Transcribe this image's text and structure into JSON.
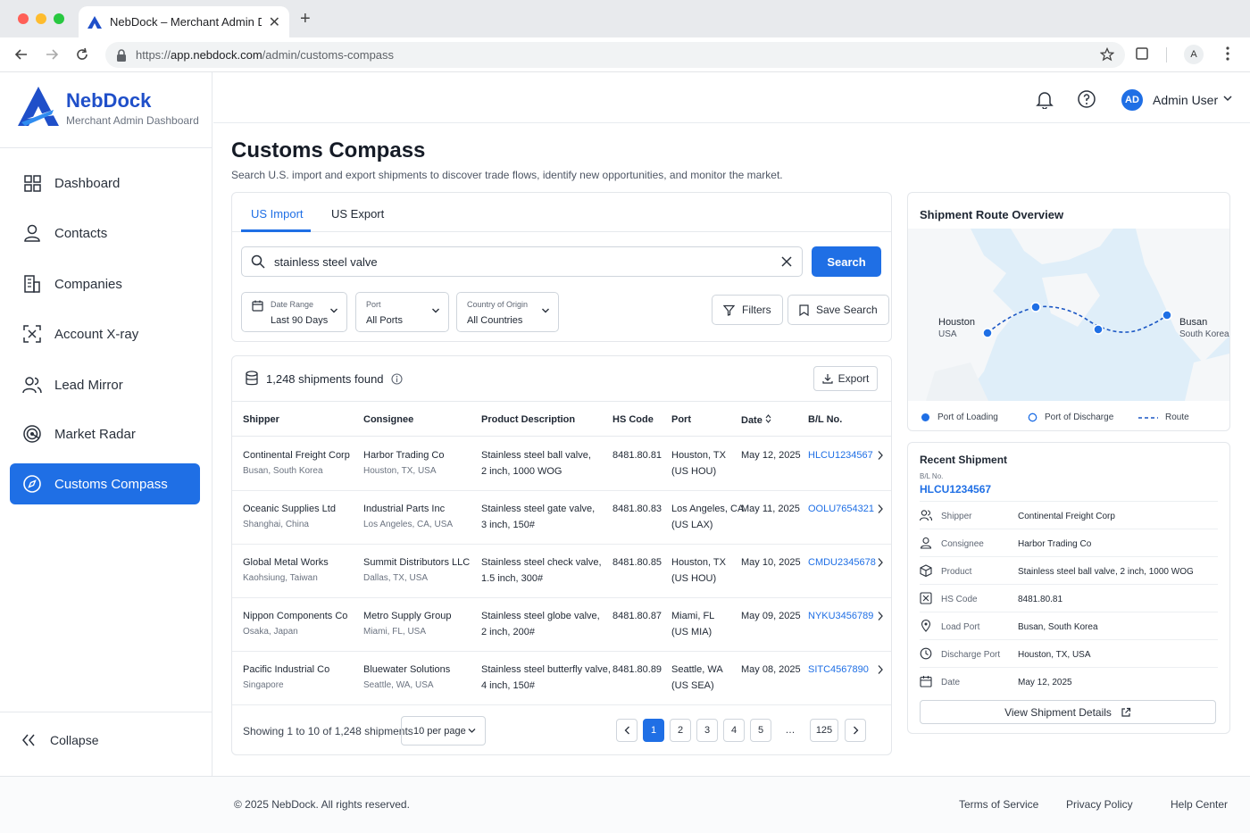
{
  "browser": {
    "tab_title": "NebDock – Merchant Admin Dashboard",
    "url_scheme": "https://",
    "url_host": "app.nebdock.com",
    "url_path": "/admin/customs-compass",
    "profile_initial": "A"
  },
  "brand": {
    "name": "NebDock",
    "subtitle": "Merchant Admin Dashboard",
    "accent": "#1f6fe5"
  },
  "sidebar": {
    "items": [
      {
        "label": "Dashboard",
        "icon": "grid-icon"
      },
      {
        "label": "Contacts",
        "icon": "user-icon"
      },
      {
        "label": "Companies",
        "icon": "building-icon"
      },
      {
        "label": "Account X-ray",
        "icon": "xray-icon"
      },
      {
        "label": "Lead Mirror",
        "icon": "users-icon"
      },
      {
        "label": "Market Radar",
        "icon": "radar-icon"
      },
      {
        "label": "Customs Compass",
        "icon": "compass-icon",
        "active": true
      }
    ],
    "collapse_label": "Collapse"
  },
  "header": {
    "avatar_initials": "AD",
    "username": "Admin User"
  },
  "page": {
    "title": "Customs Compass",
    "subtitle": "Search U.S. import and export shipments to discover trade flows, identify new opportunities, and monitor the market."
  },
  "search": {
    "tabs": [
      "US Import",
      "US Export"
    ],
    "active_tab": "US Import",
    "query": "stainless steel valve",
    "button_label": "Search",
    "filters": [
      {
        "label": "Date Range",
        "value": "Last 90 Days"
      },
      {
        "label": "Port",
        "value": "All Ports"
      },
      {
        "label": "Country of Origin",
        "value": "All Countries"
      }
    ],
    "filters_button": "Filters",
    "save_button": "Save Search"
  },
  "results": {
    "count_text": "1,248 shipments found",
    "export_label": "Export",
    "columns": [
      "Shipper",
      "Consignee",
      "Product Description",
      "HS Code",
      "Port",
      "Date",
      "B/L No."
    ],
    "rows": [
      {
        "shipper": "Continental Freight Corp",
        "shipper_loc": "Busan, South Korea",
        "consignee": "Harbor Trading Co",
        "consignee_loc": "Houston, TX, USA",
        "desc1": "Stainless steel ball valve,",
        "desc2": "2 inch, 1000 WOG",
        "hs": "8481.80.81",
        "port1": "Houston, TX",
        "port2": "(US HOU)",
        "date": "May 12, 2025",
        "bl": "HLCU1234567"
      },
      {
        "shipper": "Oceanic Supplies Ltd",
        "shipper_loc": "Shanghai, China",
        "consignee": "Industrial Parts Inc",
        "consignee_loc": "Los Angeles, CA, USA",
        "desc1": "Stainless steel gate valve,",
        "desc2": "3 inch, 150#",
        "hs": "8481.80.83",
        "port1": "Los Angeles, CA",
        "port2": "(US LAX)",
        "date": "May 11, 2025",
        "bl": "OOLU7654321"
      },
      {
        "shipper": "Global Metal Works",
        "shipper_loc": "Kaohsiung, Taiwan",
        "consignee": "Summit Distributors LLC",
        "consignee_loc": "Dallas, TX, USA",
        "desc1": "Stainless steel check valve,",
        "desc2": "1.5 inch, 300#",
        "hs": "8481.80.85",
        "port1": "Houston, TX",
        "port2": "(US HOU)",
        "date": "May 10, 2025",
        "bl": "CMDU2345678"
      },
      {
        "shipper": "Nippon Components Co",
        "shipper_loc": "Osaka, Japan",
        "consignee": "Metro Supply Group",
        "consignee_loc": "Miami, FL, USA",
        "desc1": "Stainless steel globe valve,",
        "desc2": "2 inch, 200#",
        "hs": "8481.80.87",
        "port1": "Miami, FL",
        "port2": "(US MIA)",
        "date": "May 09, 2025",
        "bl": "NYKU3456789"
      },
      {
        "shipper": "Pacific Industrial Co",
        "shipper_loc": "Singapore",
        "consignee": "Bluewater Solutions",
        "consignee_loc": "Seattle, WA, USA",
        "desc1": "Stainless steel butterfly valve,",
        "desc2": "4 inch, 150#",
        "hs": "8481.80.89",
        "port1": "Seattle, WA",
        "port2": "(US SEA)",
        "date": "May 08, 2025",
        "bl": "SITC4567890"
      }
    ],
    "showing_text": "Showing 1 to 10 of 1,248 shipments",
    "per_page": "10 per page",
    "pages": [
      "1",
      "2",
      "3",
      "4",
      "5",
      "…",
      "125"
    ],
    "current_page": "1"
  },
  "route": {
    "title": "Shipment Route Overview",
    "origin_city": "Houston",
    "origin_country": "USA",
    "dest_city": "Busan",
    "dest_country": "South Korea",
    "legend": [
      "Port of Loading",
      "Port of Discharge",
      "Route"
    ]
  },
  "recent": {
    "title": "Recent Shipment",
    "bl_label": "B/L No.",
    "bl": "HLCU1234567",
    "fields": [
      {
        "key": "Shipper",
        "value": "Continental Freight Corp",
        "icon": "users-icon"
      },
      {
        "key": "Consignee",
        "value": "Harbor Trading Co",
        "icon": "user-icon"
      },
      {
        "key": "Product",
        "value": "Stainless steel ball valve, 2 inch, 1000 WOG",
        "icon": "box-icon"
      },
      {
        "key": "HS Code",
        "value": "8481.80.81",
        "icon": "code-icon"
      },
      {
        "key": "Load Port",
        "value": "Busan, South Korea",
        "icon": "pin-icon"
      },
      {
        "key": "Discharge Port",
        "value": "Houston, TX, USA",
        "icon": "target-icon"
      },
      {
        "key": "Date",
        "value": "May 12, 2025",
        "icon": "calendar-icon"
      }
    ],
    "view_button": "View Shipment Details"
  },
  "footer": {
    "copyright": "© 2025 NebDock. All rights reserved.",
    "links": [
      "Terms of Service",
      "Privacy Policy",
      "Help Center"
    ]
  }
}
